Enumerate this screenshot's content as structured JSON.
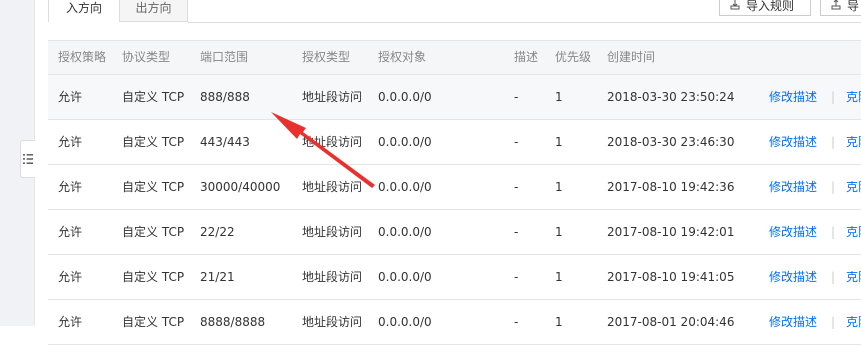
{
  "tabs": [
    {
      "label": "入方向",
      "active": true
    },
    {
      "label": "出方向",
      "active": false
    }
  ],
  "toolbar": {
    "import_label": "导入规则",
    "more_label": "导"
  },
  "table": {
    "headers": [
      "授权策略",
      "协议类型",
      "端口范围",
      "授权类型",
      "授权对象",
      "描述",
      "优先级",
      "创建时间"
    ],
    "rows": [
      {
        "policy": "允许",
        "protocol": "自定义 TCP",
        "port": "888/888",
        "auth_type": "地址段访问",
        "target": "0.0.0.0/0",
        "desc": "-",
        "priority": "1",
        "created": "2018-03-30 23:50:24",
        "op1": "修改描述",
        "sep": "|",
        "op2": "克隆"
      },
      {
        "policy": "允许",
        "protocol": "自定义 TCP",
        "port": "443/443",
        "auth_type": "地址段访问",
        "target": "0.0.0.0/0",
        "desc": "-",
        "priority": "1",
        "created": "2018-03-30 23:46:30",
        "op1": "修改描述",
        "sep": "|",
        "op2": "克隆"
      },
      {
        "policy": "允许",
        "protocol": "自定义 TCP",
        "port": "30000/40000",
        "auth_type": "地址段访问",
        "target": "0.0.0.0/0",
        "desc": "-",
        "priority": "1",
        "created": "2017-08-10 19:42:36",
        "op1": "修改描述",
        "sep": "|",
        "op2": "克隆"
      },
      {
        "policy": "允许",
        "protocol": "自定义 TCP",
        "port": "22/22",
        "auth_type": "地址段访问",
        "target": "0.0.0.0/0",
        "desc": "-",
        "priority": "1",
        "created": "2017-08-10 19:42:01",
        "op1": "修改描述",
        "sep": "|",
        "op2": "克隆"
      },
      {
        "policy": "允许",
        "protocol": "自定义 TCP",
        "port": "21/21",
        "auth_type": "地址段访问",
        "target": "0.0.0.0/0",
        "desc": "-",
        "priority": "1",
        "created": "2017-08-10 19:41:05",
        "op1": "修改描述",
        "sep": "|",
        "op2": "克隆"
      },
      {
        "policy": "允许",
        "protocol": "自定义 TCP",
        "port": "8888/8888",
        "auth_type": "地址段访问",
        "target": "0.0.0.0/0",
        "desc": "-",
        "priority": "1",
        "created": "2017-08-01 20:04:46",
        "op1": "修改描述",
        "sep": "|",
        "op2": "克隆"
      }
    ]
  },
  "annotation": {
    "color": "#e8312f"
  },
  "colors": {
    "link": "#006eff",
    "header_bg": "#f4f6f8",
    "border": "#e5e5e5"
  }
}
